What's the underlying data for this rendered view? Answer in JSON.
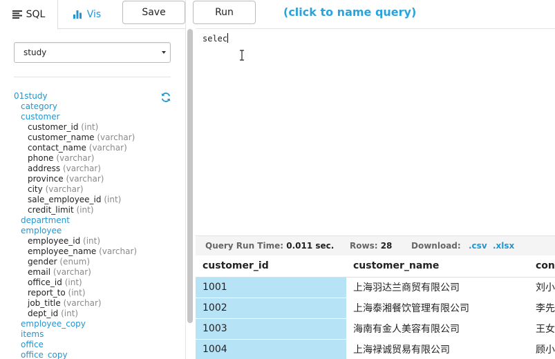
{
  "tabs": [
    {
      "label": "SQL",
      "icon": "list-icon",
      "active": true
    },
    {
      "label": "Vis",
      "icon": "bar-chart-icon",
      "active": false
    }
  ],
  "toolbar": {
    "save_label": "Save",
    "run_label": "Run",
    "query_name_prompt": "(click to name query)"
  },
  "schema_select": {
    "value": "study"
  },
  "tree": {
    "database": "01study",
    "items": [
      {
        "kind": "table",
        "name": "category"
      },
      {
        "kind": "table",
        "name": "customer"
      },
      {
        "kind": "col",
        "name": "customer_id",
        "type": "(int)"
      },
      {
        "kind": "col",
        "name": "customer_name",
        "type": "(varchar)"
      },
      {
        "kind": "col",
        "name": "contact_name",
        "type": "(varchar)"
      },
      {
        "kind": "col",
        "name": "phone",
        "type": "(varchar)"
      },
      {
        "kind": "col",
        "name": "address",
        "type": "(varchar)"
      },
      {
        "kind": "col",
        "name": "province",
        "type": "(varchar)"
      },
      {
        "kind": "col",
        "name": "city",
        "type": "(varchar)"
      },
      {
        "kind": "col",
        "name": "sale_employee_id",
        "type": "(int)"
      },
      {
        "kind": "col",
        "name": "credit_limit",
        "type": "(int)"
      },
      {
        "kind": "table",
        "name": "department"
      },
      {
        "kind": "table",
        "name": "employee"
      },
      {
        "kind": "col",
        "name": "employee_id",
        "type": "(int)"
      },
      {
        "kind": "col",
        "name": "employee_name",
        "type": "(varchar)"
      },
      {
        "kind": "col",
        "name": "gender",
        "type": "(enum)"
      },
      {
        "kind": "col",
        "name": "email",
        "type": "(varchar)"
      },
      {
        "kind": "col",
        "name": "office_id",
        "type": "(int)"
      },
      {
        "kind": "col",
        "name": "report_to",
        "type": "(int)"
      },
      {
        "kind": "col",
        "name": "job_title",
        "type": "(varchar)"
      },
      {
        "kind": "col",
        "name": "dept_id",
        "type": "(int)"
      },
      {
        "kind": "table",
        "name": "employee_copy"
      },
      {
        "kind": "table",
        "name": "items"
      },
      {
        "kind": "table",
        "name": "office"
      },
      {
        "kind": "table",
        "name": "office_copy"
      }
    ]
  },
  "editor": {
    "text": "selec"
  },
  "results": {
    "runtime_label": "Query Run Time:",
    "runtime_value": "0.011 sec.",
    "rows_label": "Rows:",
    "rows_value": "28",
    "download_label": "Download:",
    "csv_label": ".csv",
    "xlsx_label": ".xlsx",
    "columns": [
      "customer_id",
      "customer_name",
      "con"
    ],
    "rows": [
      [
        "1001",
        "上海羽达兰商贸有限公司",
        "刘小"
      ],
      [
        "1002",
        "上海泰湘餐饮管理有限公司",
        "李先"
      ],
      [
        "1003",
        "海南有金人美容有限公司",
        "王女"
      ],
      [
        "1004",
        "上海禄诚贸易有限公司",
        "顾小"
      ]
    ]
  },
  "colors": {
    "accent": "#2196d3",
    "selected_cell": "#b7e3f6"
  }
}
